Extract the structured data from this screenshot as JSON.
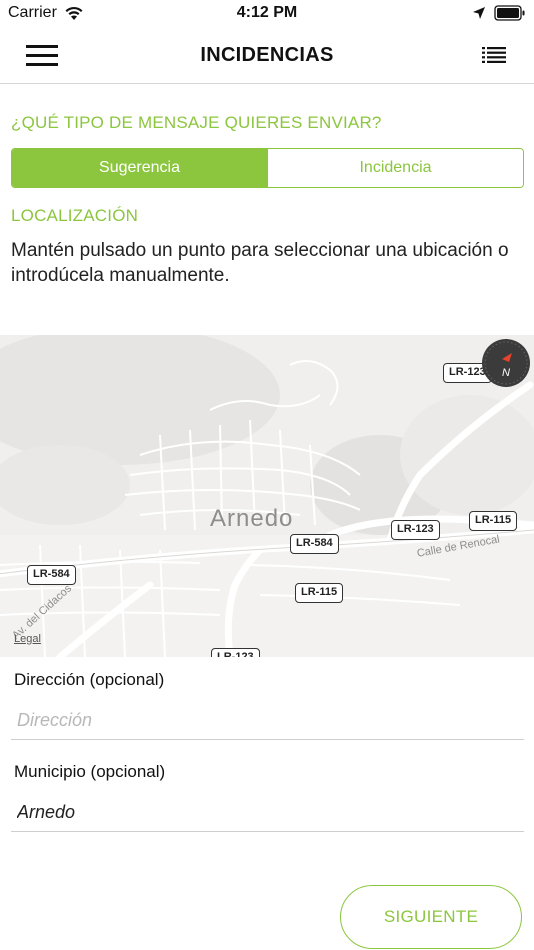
{
  "status": {
    "carrier": "Carrier",
    "time": "4:12 PM"
  },
  "nav": {
    "title": "INCIDENCIAS"
  },
  "message_type": {
    "label": "¿QUÉ TIPO DE MENSAJE QUIERES ENVIAR?",
    "options": [
      "Sugerencia",
      "Incidencia"
    ],
    "selected": "Sugerencia"
  },
  "location": {
    "label": "LOCALIZACIÓN",
    "help": "Mantén pulsado un punto para seleccionar una ubicación o introdúcela manualmente."
  },
  "map": {
    "city": "Arnedo",
    "roads": [
      "LR-123",
      "LR-123",
      "LR-115",
      "LR-584",
      "LR-584",
      "LR-115",
      "LR-123"
    ],
    "streets": [
      "Calle de Renocal",
      "Av. del Cidacos"
    ],
    "legal": "Legal",
    "compass_letter": "N"
  },
  "form": {
    "address_label": "Dirección (opcional)",
    "address_placeholder": "Dirección",
    "address_value": "",
    "municipality_label": "Municipio (opcional)",
    "municipality_value": "Arnedo"
  },
  "actions": {
    "next_label": "SIGUIENTE"
  },
  "colors": {
    "accent": "#8cc63f"
  }
}
